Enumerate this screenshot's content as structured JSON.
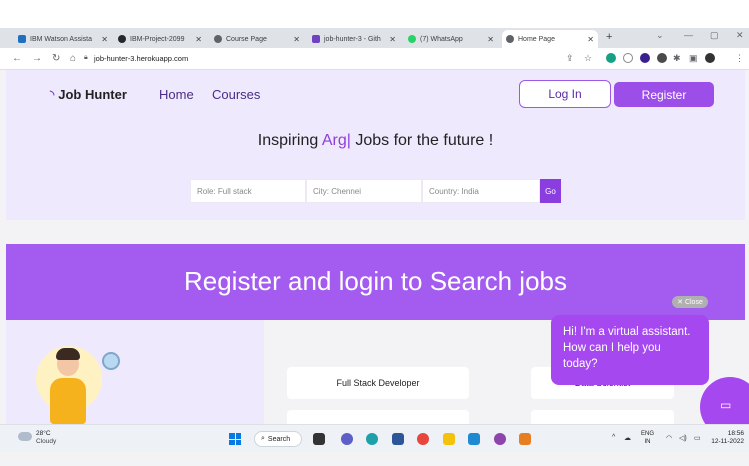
{
  "browser": {
    "tabs": [
      {
        "label": "IBM Watson Assista",
        "color": "#1f70c1"
      },
      {
        "label": "IBM-Project-2099",
        "color": "#24292f"
      },
      {
        "label": "Course Page",
        "color": "#5f6368"
      },
      {
        "label": "job-hunter-3 - Gith",
        "color": "#6f42c1"
      },
      {
        "label": "(7) WhatsApp",
        "color": "#25d366"
      },
      {
        "label": "Home Page",
        "color": "#5f6368"
      }
    ],
    "new_tab": "+",
    "url": "job-hunter-3.herokuapp.com"
  },
  "site": {
    "brand": "Job Hunter",
    "nav": {
      "home": "Home",
      "courses": "Courses"
    },
    "login_label": "Log In",
    "register_label": "Register",
    "tagline_prefix": "Inspiring",
    "tagline_accent": "Arg|",
    "tagline_suffix": "Jobs for the future !",
    "search": {
      "role_placeholder": "Role: Full stack",
      "city_placeholder": "City: Chennei",
      "country_placeholder": "Country: India",
      "go_label": "Go"
    },
    "banner_title": "Register and login to Search jobs",
    "job_cards": [
      "Full Stack Developer",
      "Data Scientist"
    ]
  },
  "chat": {
    "close_label": "✕ Close",
    "message": "Hi! I'm a virtual assistant. How can I help you today?"
  },
  "taskbar": {
    "weather_temp": "28°C",
    "weather_desc": "Cloudy",
    "search_label": "Search",
    "lang_1": "ENG",
    "lang_2": "IN",
    "time": "18:56",
    "date": "12-11-2022"
  },
  "colors": {
    "accent": "#9b4ee8",
    "banner": "#a35bf0",
    "hero_bg": "#efe9fd"
  }
}
